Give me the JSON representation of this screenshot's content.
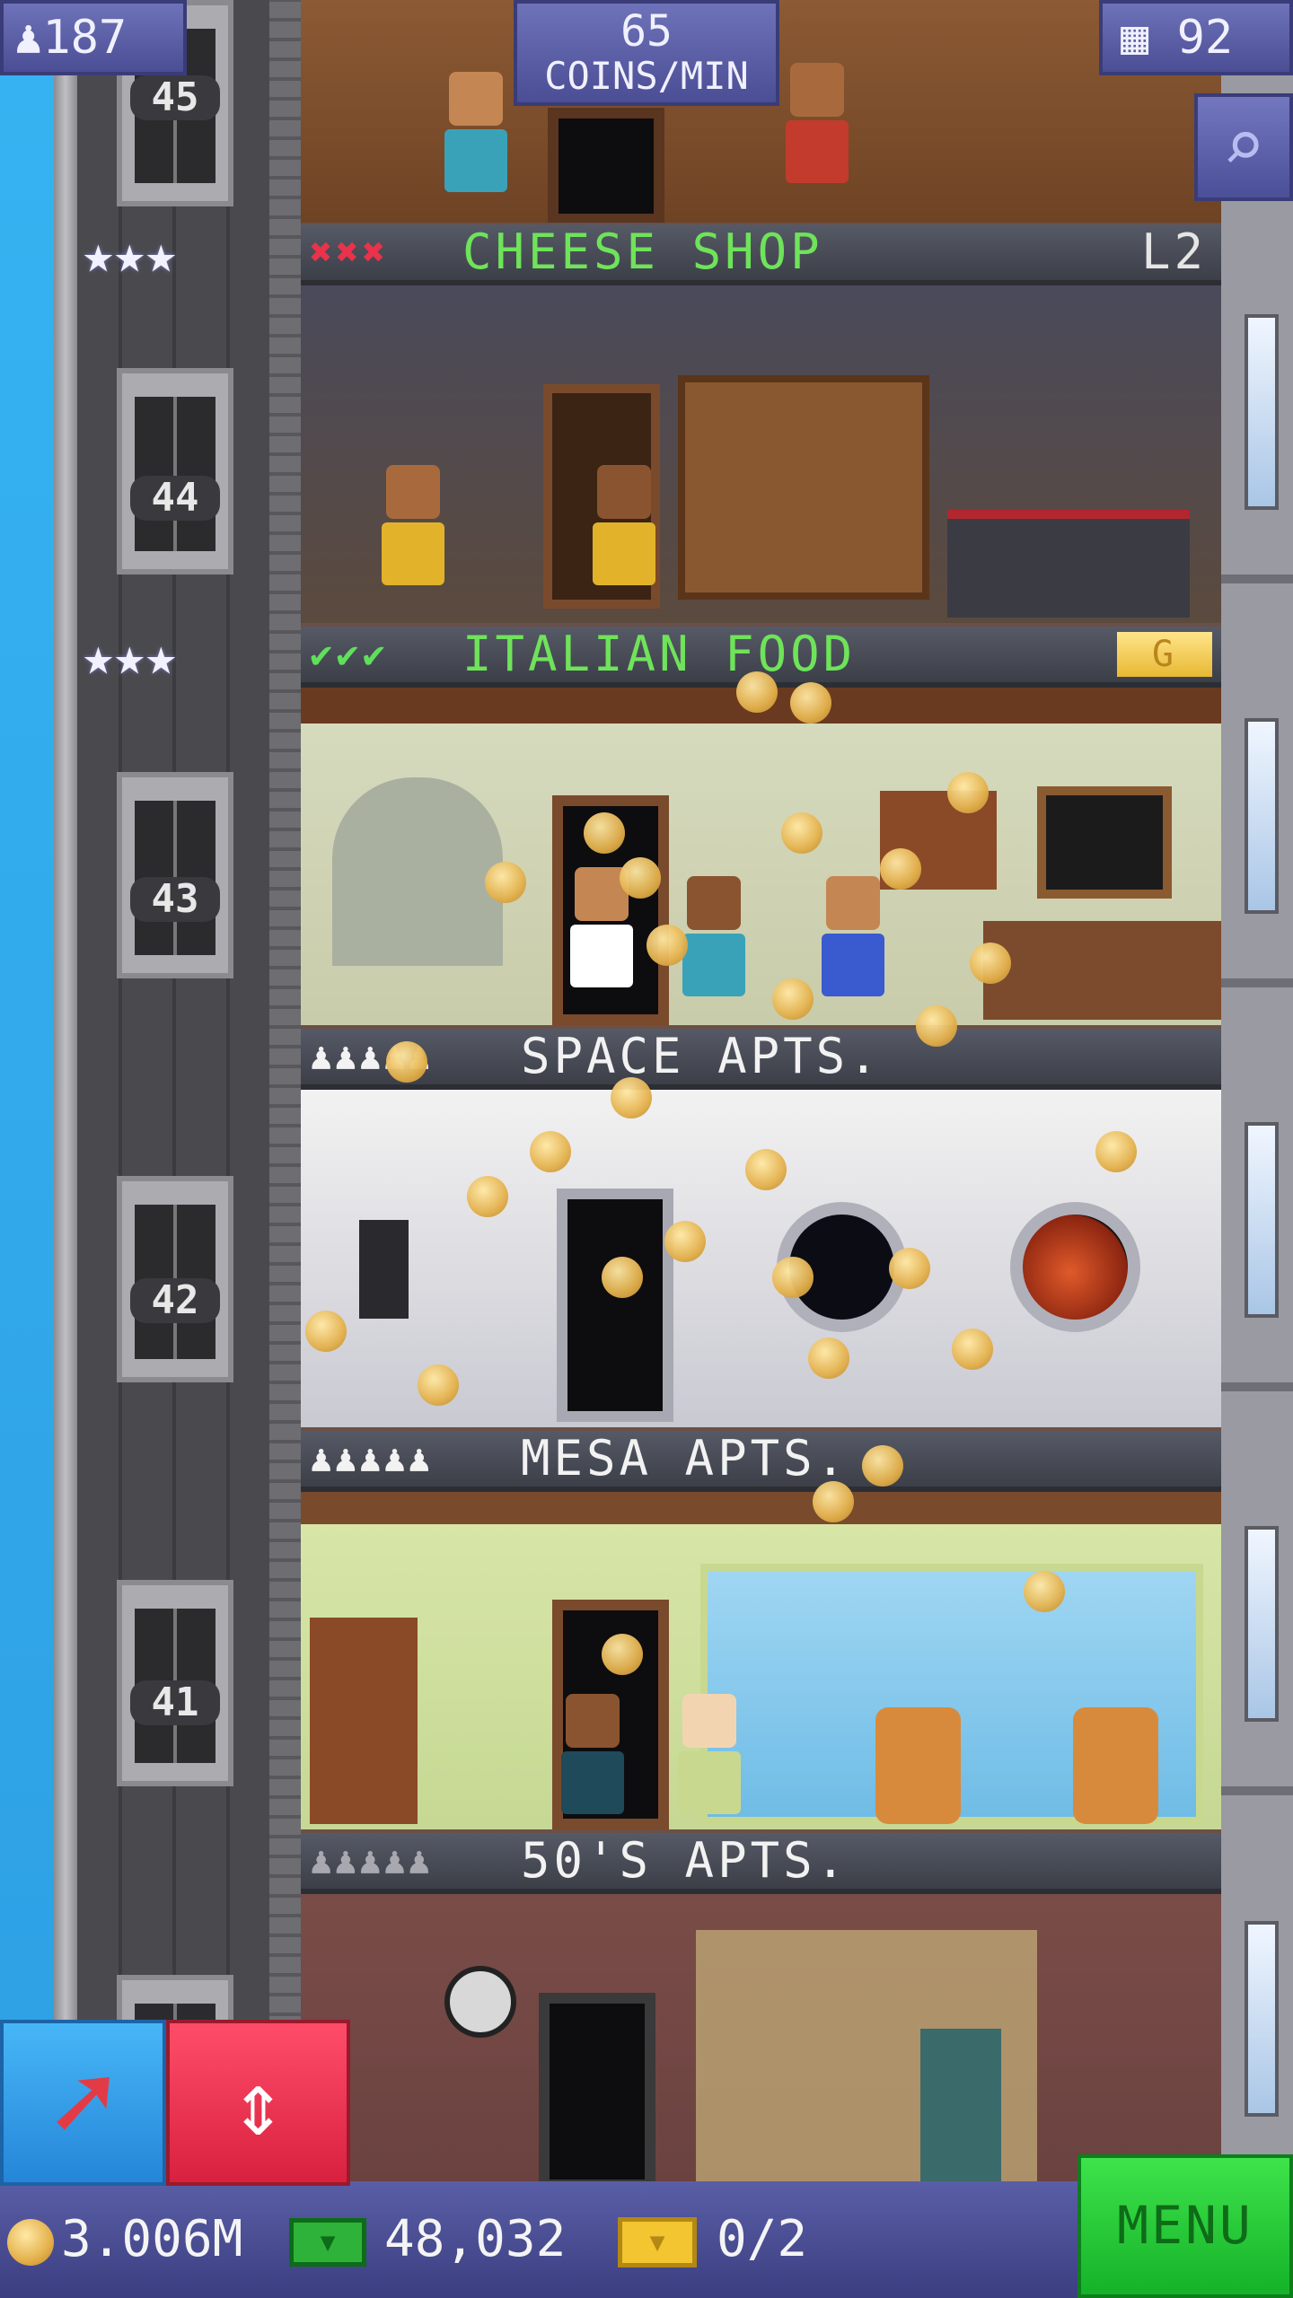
{
  "hud": {
    "population": "187",
    "coins_per_min_value": "65",
    "coins_per_min_label": "COINS/MIN",
    "floors": "92"
  },
  "elevator_floors": [
    "45",
    "44",
    "43",
    "42",
    "41"
  ],
  "floors": [
    {
      "name": "CHEESE SHOP",
      "status_icons": "✖✖✖",
      "level": "L2",
      "stars": "★★★"
    },
    {
      "name": "ITALIAN FOOD",
      "status_icons": "✔✔✔",
      "badge": "G",
      "stars": "★★★"
    },
    {
      "name": "SPACE APTS.",
      "residents": "♟♟♟♟♟"
    },
    {
      "name": "MESA APTS.",
      "residents": "♟♟♟♟♟"
    },
    {
      "name": "50'S APTS.",
      "residents": "♟♟♟♟♟"
    }
  ],
  "bottom": {
    "coins": "3.006M",
    "bux": "48,032",
    "tickets": "0/2",
    "menu_label": "MENU"
  },
  "colors": {
    "hud_purple": "#5a5ea6",
    "menu_green": "#2bc83b",
    "label_green": "#6fe35a",
    "error_red": "#e8334b",
    "tool_blue": "#2f9be8",
    "tool_red": "#e8304f"
  },
  "icons": {
    "population": "person-icon",
    "floors": "building-icon",
    "search": "magnifier-icon",
    "coin": "coin-icon",
    "bux": "bux-icon",
    "ticket": "ticket-icon",
    "raise": "arrow-up-right-icon",
    "elevator": "elevator-updown-icon"
  }
}
